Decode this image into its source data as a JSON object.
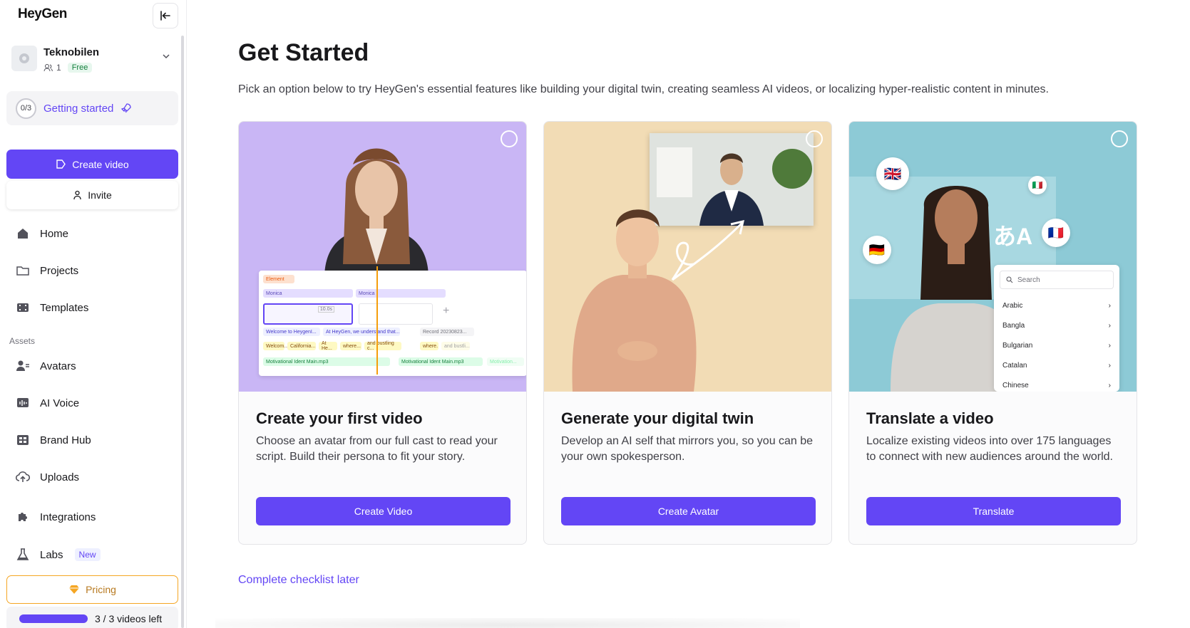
{
  "app": {
    "logo": "HeyGen"
  },
  "workspace": {
    "name": "Teknobilen",
    "member_count": "1",
    "plan": "Free"
  },
  "getting_started": {
    "progress": "0/3",
    "label": "Getting started"
  },
  "sidebar": {
    "create_label": "Create video",
    "invite_label": "Invite",
    "nav": [
      {
        "label": "Home",
        "icon": "home-icon"
      },
      {
        "label": "Projects",
        "icon": "folder-icon"
      },
      {
        "label": "Templates",
        "icon": "film-icon"
      }
    ],
    "assets_label": "Assets",
    "assets": [
      {
        "label": "Avatars",
        "icon": "avatar-icon"
      },
      {
        "label": "AI Voice",
        "icon": "voice-icon"
      },
      {
        "label": "Brand Hub",
        "icon": "brand-icon"
      },
      {
        "label": "Uploads",
        "icon": "upload-cloud-icon"
      },
      {
        "label": "Integrations",
        "icon": "puzzle-icon"
      },
      {
        "label": "Labs",
        "icon": "flask-icon",
        "badge": "New"
      }
    ],
    "pricing_label": "Pricing",
    "videos_left": "3 / 3 videos left",
    "videos_left_fraction": 1.0
  },
  "main": {
    "title": "Get Started",
    "subtitle": "Pick an option below to try HeyGen's essential features like building your digital twin, creating seamless AI videos, or localizing hyper-realistic content in minutes.",
    "cards": [
      {
        "title": "Create your first video",
        "description": "Choose an avatar from our full cast to read your script. Build their persona to fit your story.",
        "button": "Create Video",
        "media": {
          "element_chip": "Element",
          "track_name": "Monica",
          "duration": "10.0s",
          "script_1": "Welcome to HeygenI...",
          "script_2": "At HeyGen, we understand that...",
          "record_label": "Record 20230823...",
          "words": [
            "Welcom...",
            "California...",
            "At He...",
            "where...",
            "and bustling c...",
            "where.",
            "and bustli..."
          ],
          "audio_1": "Motivational Ident Main.mp3",
          "audio_2": "Motivational Ident Main.mp3",
          "audio_3": "Motivation..."
        }
      },
      {
        "title": "Generate your digital twin",
        "description": "Develop an AI self that mirrors you, so you can be your own spokesperson.",
        "button": "Create Avatar"
      },
      {
        "title": "Translate a video",
        "description": "Localize existing videos into over 175 languages to connect with new audiences around the world.",
        "button": "Translate",
        "media": {
          "search_placeholder": "Search",
          "languages": [
            "Arabic",
            "Bangla",
            "Bulgarian",
            "Catalan",
            "Chinese"
          ],
          "glyph": "あA"
        }
      }
    ],
    "checklist_later": "Complete checklist later"
  },
  "colors": {
    "accent": "#6346f5",
    "card1_bg": "#c9b6f5",
    "card2_bg": "#f2dcb5",
    "card3_bg": "#8dcad6"
  }
}
